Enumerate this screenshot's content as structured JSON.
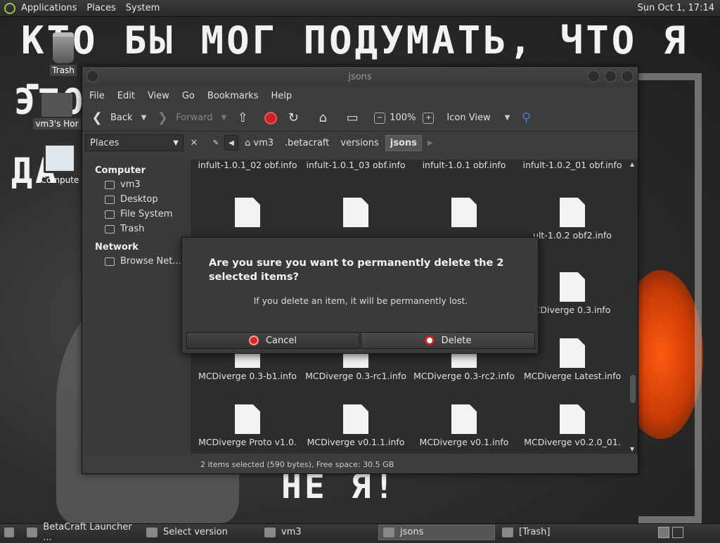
{
  "top_panel": {
    "menus": [
      "Applications",
      "Places",
      "System"
    ],
    "clock": "Sun Oct  1, 17:14"
  },
  "wallpaper": {
    "line1": "КТО БЫ МОГ ПОДУМАТЬ, ЧТО Я -",
    "line2": "ЭТО",
    "line3": "ДА",
    "line4": "НЕ Я!"
  },
  "desktop": {
    "trash": "Trash",
    "home": "vm3's Hor",
    "computer": "Compute"
  },
  "window": {
    "title": "jsons",
    "menu": [
      "File",
      "Edit",
      "View",
      "Go",
      "Bookmarks",
      "Help"
    ],
    "toolbar": {
      "back": "Back",
      "forward": "Forward",
      "zoom": "100%",
      "view_mode": "Icon View"
    },
    "places_label": "Places",
    "breadcrumbs": [
      "vm3",
      ".betacraft",
      "versions",
      "jsons"
    ],
    "sidebar": {
      "computer_heading": "Computer",
      "computer_items": [
        "vm3",
        "Desktop",
        "File System",
        "Trash"
      ],
      "network_heading": "Network",
      "network_items": [
        "Browse Net..."
      ]
    },
    "files": [
      "infult-1.0.1_02 obf.info",
      "infult-1.0.1_03 obf.info",
      "infult-1.0.1 obf.info",
      "infult-1.0.2_01 obf.info",
      "",
      "",
      "",
      "ult-1.0.2 obf2.info",
      "",
      "",
      "",
      "CDiverge 0.3.info",
      "MCDiverge 0.3-b1.info",
      "MCDiverge 0.3-rc1.info",
      "MCDiverge 0.3-rc2.info",
      "MCDiverge Latest.info",
      "MCDiverge Proto v1.0.",
      "MCDiverge v0.1.1.info",
      "MCDiverge v0.1.info",
      "MCDiverge v0.2.0_01."
    ],
    "status": "2 items selected (590 bytes), Free space: 30.5 GB"
  },
  "dialog": {
    "title": "Are you sure you want to permanently delete the 2 selected items?",
    "message": "If you delete an item, it will be permanently lost.",
    "cancel": "Cancel",
    "delete": "Delete"
  },
  "taskbar": {
    "tasks": [
      "BetaCraft Launcher ...",
      "Select version",
      "vm3",
      "jsons",
      "[Trash]"
    ]
  }
}
